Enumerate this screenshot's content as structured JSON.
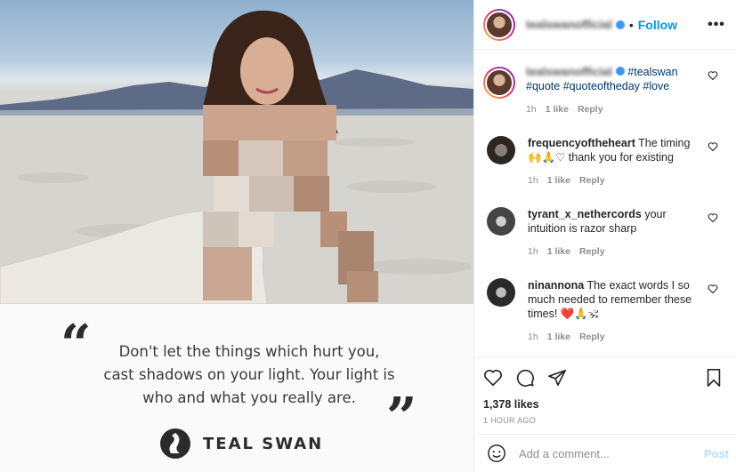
{
  "header": {
    "username_blurred": "tealswanofficial",
    "separator": "•",
    "follow_label": "Follow",
    "more_label": "•••"
  },
  "caption": {
    "username_blurred": "tealswanofficial",
    "text": "#tealswan #quote #quoteoftheday #love",
    "time": "1h",
    "likes": "1 like",
    "reply": "Reply"
  },
  "comments": [
    {
      "username": "frequencyoftheheart",
      "text": "The timing 🙌🙏♡ thank you for existing",
      "time": "1h",
      "likes": "1 like",
      "reply": "Reply"
    },
    {
      "username": "tyrant_x_nethercords",
      "text": "your intuition is razor sharp",
      "time": "1h",
      "likes": "1 like",
      "reply": "Reply"
    },
    {
      "username": "ninannona",
      "text": "The exact words I so much needed to remember these times! ❤️🙏🕉",
      "time": "1h",
      "likes": "1 like",
      "reply": "Reply"
    }
  ],
  "post": {
    "likes": "1,378 likes",
    "timestamp": "1 HOUR AGO"
  },
  "comment_box": {
    "placeholder": "Add a comment...",
    "post_label": "Post"
  },
  "image": {
    "quote_line1": "Don't let the things which hurt you,",
    "quote_line2": "cast shadows on your light. Your light is",
    "quote_line3": "who and what you really are.",
    "open_quote": "“",
    "close_quote": "”",
    "brand": "TEAL SWAN"
  },
  "colors": {
    "link_blue": "#0095f6",
    "hashtag": "#00376b",
    "muted": "#8e8e8e",
    "post_disabled": "#b2dffc"
  }
}
